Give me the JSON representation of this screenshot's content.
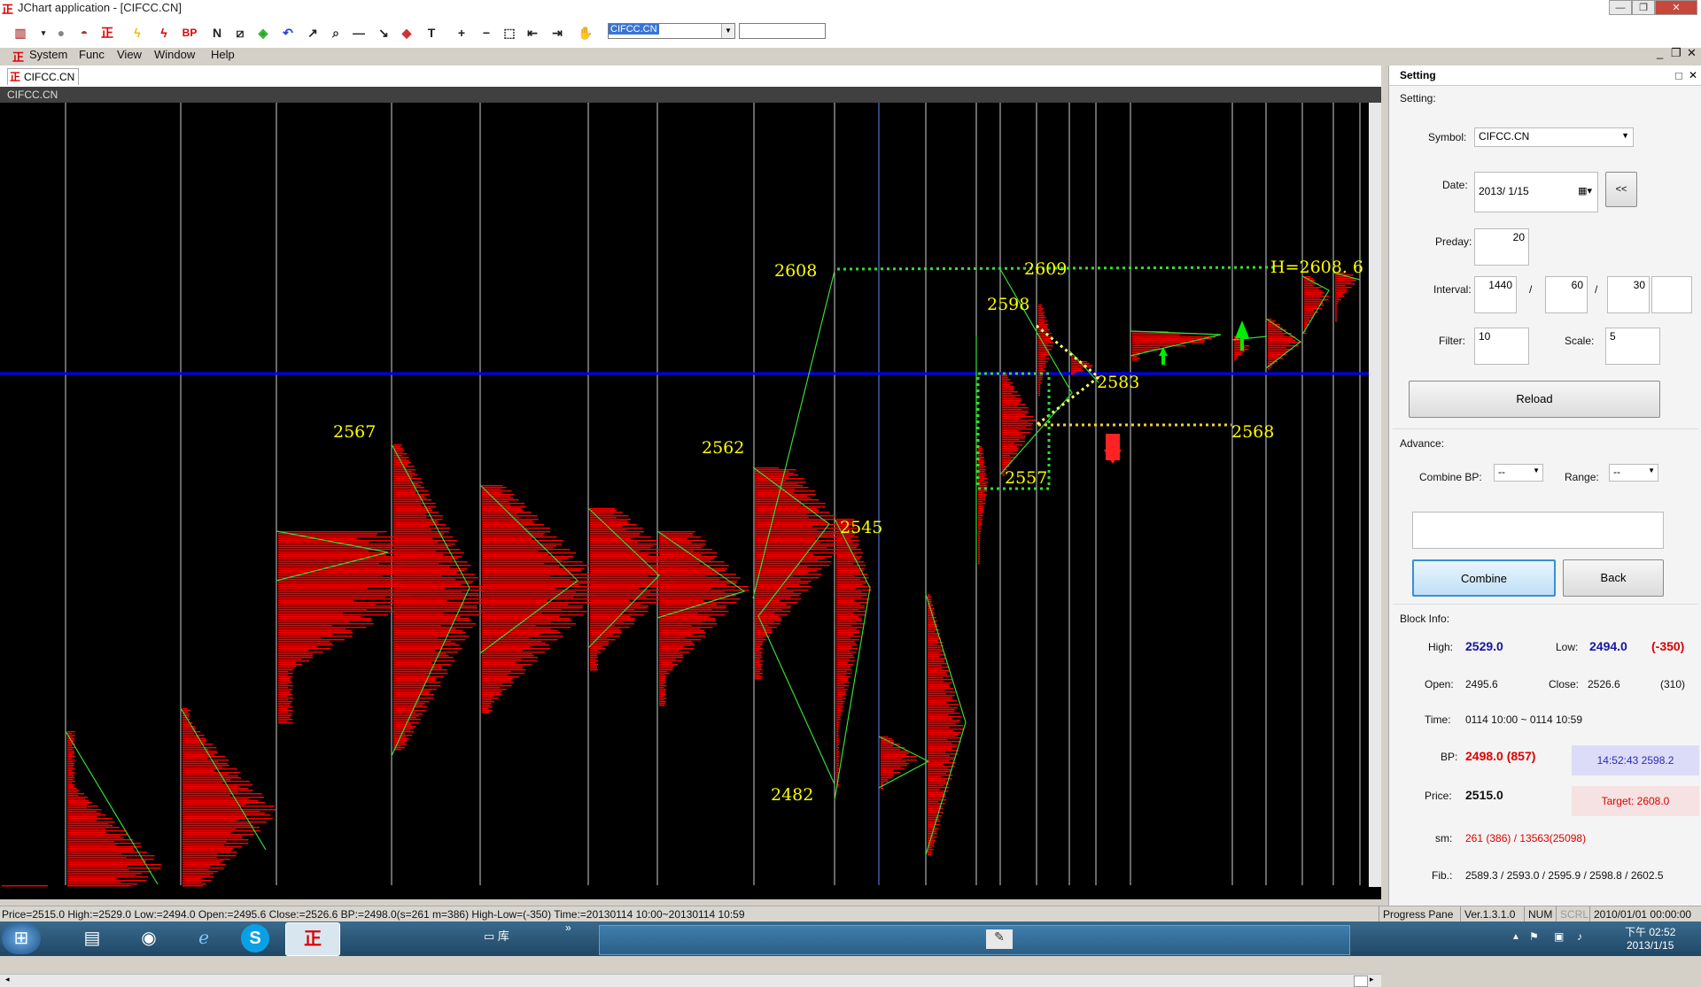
{
  "window": {
    "title": "JChart application - [CIFCC.CN]",
    "logo": "正"
  },
  "toolbar": {
    "symbol_value": "CIFCC.CN",
    "icons": [
      "chart-type-icon",
      "circle-icon",
      "car-icon",
      "logo-icon",
      "lightning-icon",
      "lightning-red-icon",
      "bp-icon",
      "n-icon",
      "n-slash-icon",
      "cube-icon",
      "undo-icon",
      "arrow-icon",
      "zoom-icon",
      "h-line-icon",
      "diag-line-icon",
      "color-icon",
      "text-icon",
      "plus-icon",
      "minus-icon",
      "select-icon",
      "back-icon",
      "forward-icon",
      "hand-icon"
    ],
    "bp_label": "BP",
    "n_label": "N",
    "t_label": "T"
  },
  "menu": {
    "items": [
      "System",
      "Func",
      "View",
      "Window",
      "Help"
    ]
  },
  "doc_tab": {
    "label": "CIFCC.CN"
  },
  "chart": {
    "symbol_tag": "CIFCC.CN",
    "labels": [
      "2608",
      "2609",
      "H=2608. 6",
      "2598",
      "2583",
      "2568",
      "2557",
      "2567",
      "2562",
      "2545",
      "2482"
    ],
    "hline_color": "#0000ff",
    "profile_color": "#ff0000",
    "guide_color": "#00ff00",
    "label_color": "#ffff00"
  },
  "statusbar": {
    "text": "Price=2515.0  High:=2529.0  Low:=2494.0  Open:=2495.6  Close:=2526.6  BP:=2498.0(s=261 m=386)  High-Low=(-350)  Time:=20130114 10:00~20130114 10:59",
    "progress": "Progress Pane",
    "version": "Ver.1.3.1.0",
    "num": "NUM",
    "scrl": "SCRL",
    "datetime": "2010/01/01 00:00:00"
  },
  "panel": {
    "title": "Setting",
    "setting_label": "Setting:",
    "symbol_label": "Symbol:",
    "symbol_value": "CIFCC.CN",
    "date_label": "Date:",
    "date_value": "2013/  1/15",
    "prev_btn": "<<",
    "preday_label": "Preday:",
    "preday_value": "20",
    "interval_label": "Interval:",
    "interval_values": [
      "1440",
      "60",
      "30",
      ""
    ],
    "sep": "/",
    "filter_label": "Filter:",
    "filter_value": "10",
    "scale_label": "Scale:",
    "scale_value": "5",
    "reload_btn": "Reload",
    "advance_label": "Advance:",
    "combine_bp_label": "Combine BP:",
    "combine_bp_value": "--",
    "range_label": "Range:",
    "range_value": "--",
    "combine_btn": "Combine",
    "back_btn": "Back",
    "block_info_label": "Block Info:",
    "high_label": "High:",
    "high_value": "2529.0",
    "low_label": "Low:",
    "low_value": "2494.0",
    "low_diff": "(-350)",
    "open_label": "Open:",
    "open_value": "2495.6",
    "close_label": "Close:",
    "close_value": "2526.6",
    "close_diff": "(310)",
    "time_label": "Time:",
    "time_value": "0114 10:00 ~ 0114 10:59",
    "bp_label": "BP:",
    "bp_value": "2498.0 (857)",
    "bp_time": "14:52:43  2598.2",
    "price_label": "Price:",
    "price_value": "2515.0",
    "target": "Target: 2608.0",
    "sm_label": "sm:",
    "sm_value": "261 (386) / 13563(25098)",
    "fib_label": "Fib.:",
    "fib_value": "2589.3 / 2593.0 / 2595.9 / 2598.8 / 2602.5"
  },
  "taskbar": {
    "start_icon": "windows-start-icon",
    "apps": [
      "explorer-icon",
      "chrome-icon",
      "ie-icon",
      "skype-icon",
      "jchart-icon"
    ],
    "folder_label": "库",
    "time": "下午 02:52",
    "date": "2013/1/15"
  }
}
